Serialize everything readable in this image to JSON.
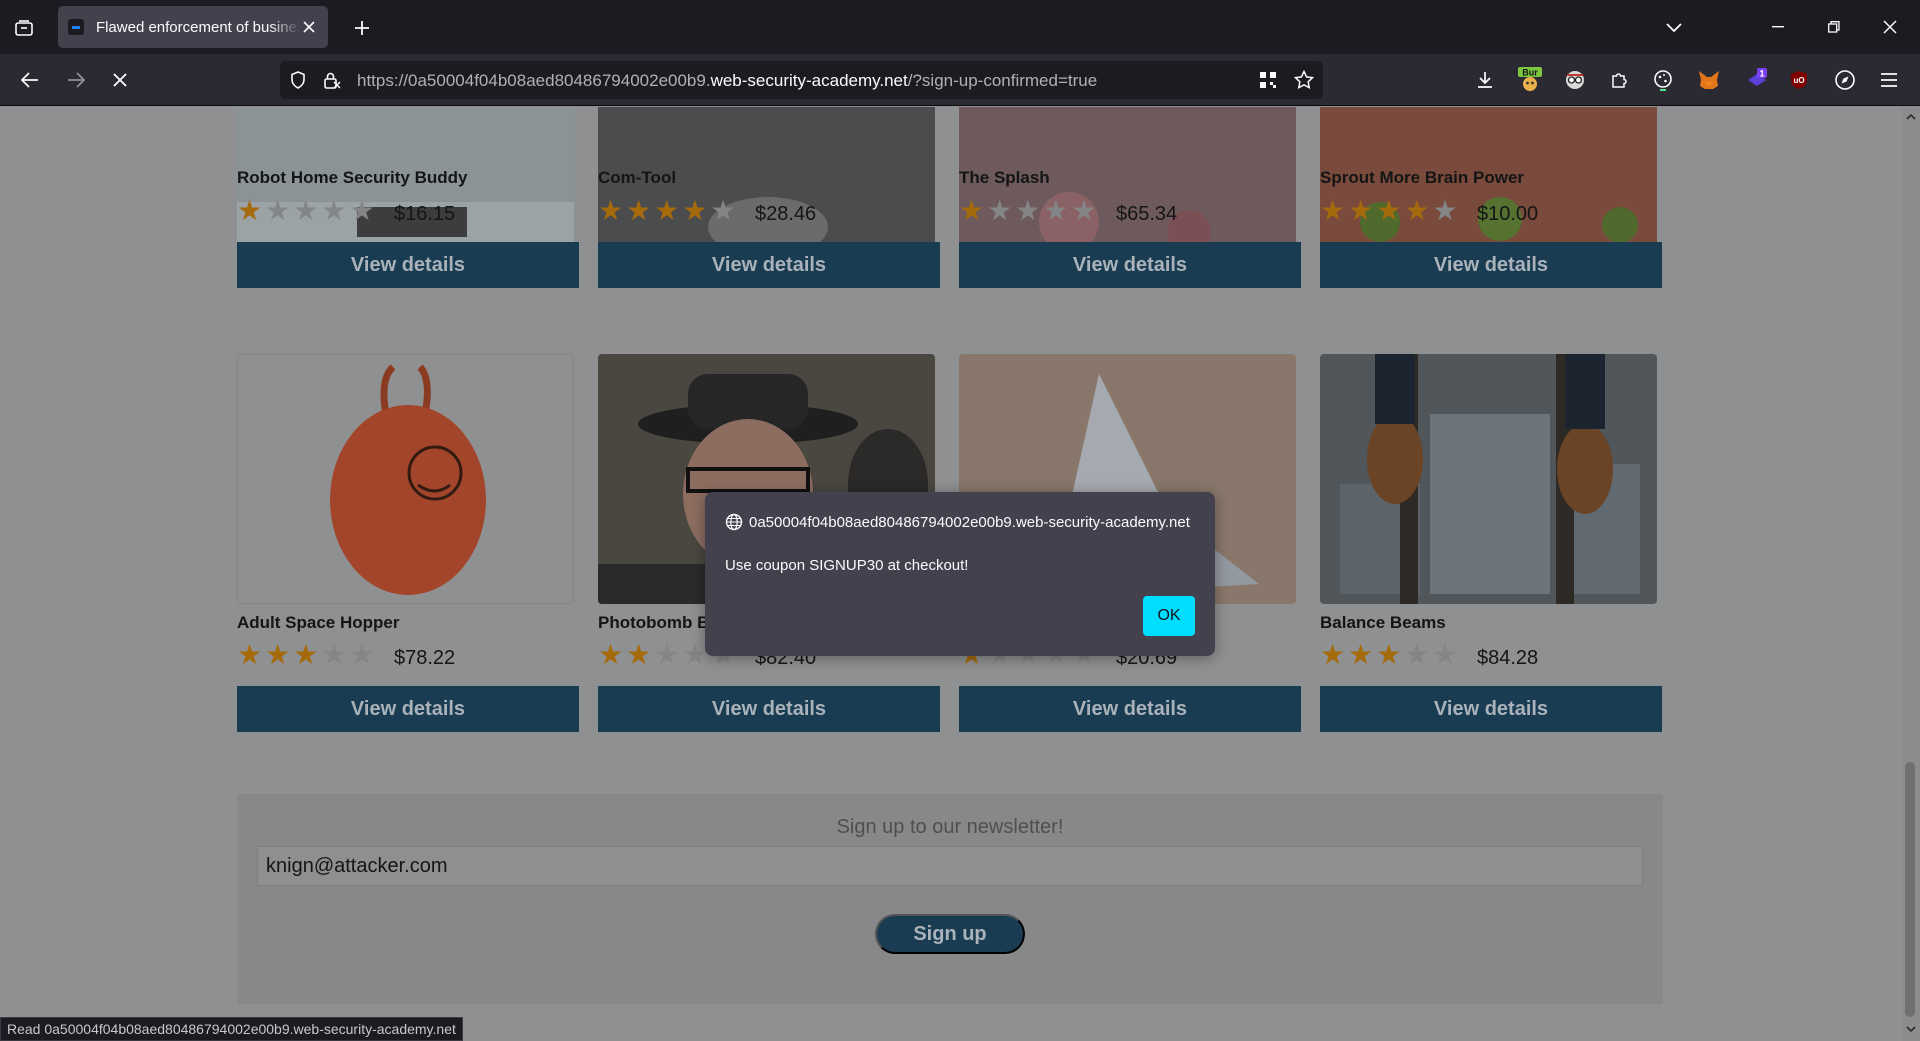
{
  "browser": {
    "tab_title": "Flawed enforcement of business rules",
    "url_prefix": "https://0a50004f04b08aed80486794002e00b9.",
    "url_host": "web-security-academy.net",
    "url_suffix": "/?sign-up-confirmed=true",
    "ext_burp_label": "Bur",
    "ext_badge": "1",
    "ext_ublock_label": "uO",
    "status_text": "Read 0a50004f04b08aed80486794002e00b9.web-security-academy.net"
  },
  "products_row1": [
    {
      "name": "Robot Home Security Buddy",
      "price": "$16.15",
      "rating": 1,
      "button": "View details"
    },
    {
      "name": "Com-Tool",
      "price": "$28.46",
      "rating": 4,
      "button": "View details"
    },
    {
      "name": "The Splash",
      "price": "$65.34",
      "rating": 1,
      "button": "View details"
    },
    {
      "name": "Sprout More Brain Power",
      "price": "$10.00",
      "rating": 4,
      "button": "View details"
    }
  ],
  "products_row2": [
    {
      "name": "Adult Space Hopper",
      "price": "$78.22",
      "rating": 3,
      "button": "View details"
    },
    {
      "name": "Photobomb Ba",
      "price": "$82.40",
      "rating": 2,
      "button": "View details"
    },
    {
      "name": "",
      "price": "$20.69",
      "rating": 1,
      "button": "View details"
    },
    {
      "name": "Balance Beams",
      "price": "$84.28",
      "rating": 3,
      "button": "View details"
    }
  ],
  "newsletter": {
    "title": "Sign up to our newsletter!",
    "email_value": "knign@attacker.com",
    "button": "Sign up"
  },
  "dialog": {
    "origin": "0a50004f04b08aed80486794002e00b9.web-security-academy.net",
    "message": "Use coupon SIGNUP30 at checkout!",
    "ok_label": "OK"
  },
  "colors": {
    "button_bg": "#193c52",
    "dialog_ok": "#00ddff",
    "star_on": "#a56a0c"
  }
}
